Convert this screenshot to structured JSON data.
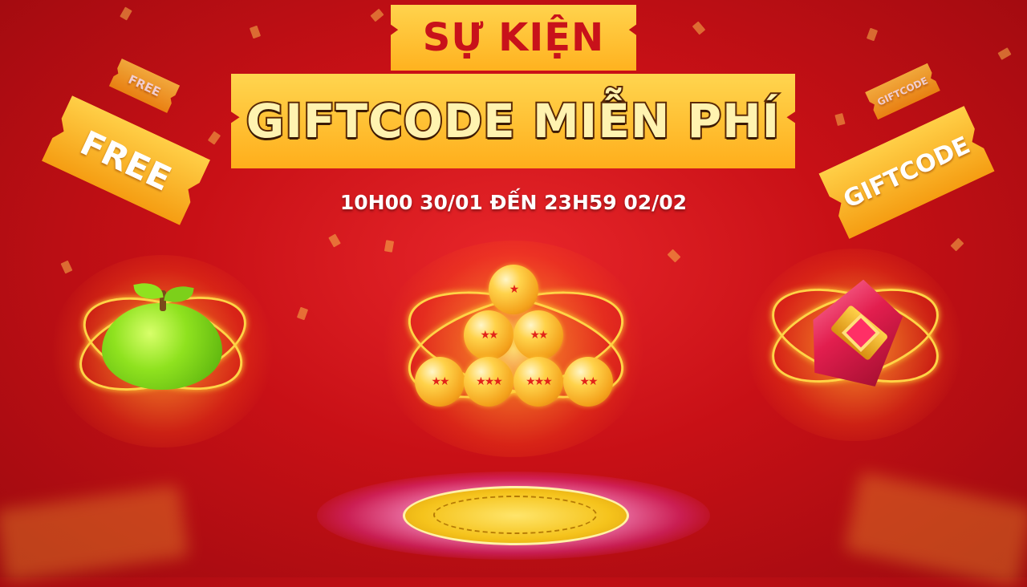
{
  "event_label": "SỰ KIỆN",
  "title": "GIFTCODE MIỄN PHÍ",
  "date_range": "10H00 30/01 ĐẾN 23H59 02/02",
  "tickets": {
    "left_large": "FREE",
    "left_small": "FREE",
    "right_large": "GIFTCODE",
    "right_small": "GIFTCODE"
  },
  "colors": {
    "background": "#c81016",
    "banner_gold": "#ffb21f",
    "title_text": "#fff3b0",
    "event_text": "#c8121a"
  },
  "items": [
    "green-apple",
    "dragon-balls",
    "red-gem"
  ]
}
